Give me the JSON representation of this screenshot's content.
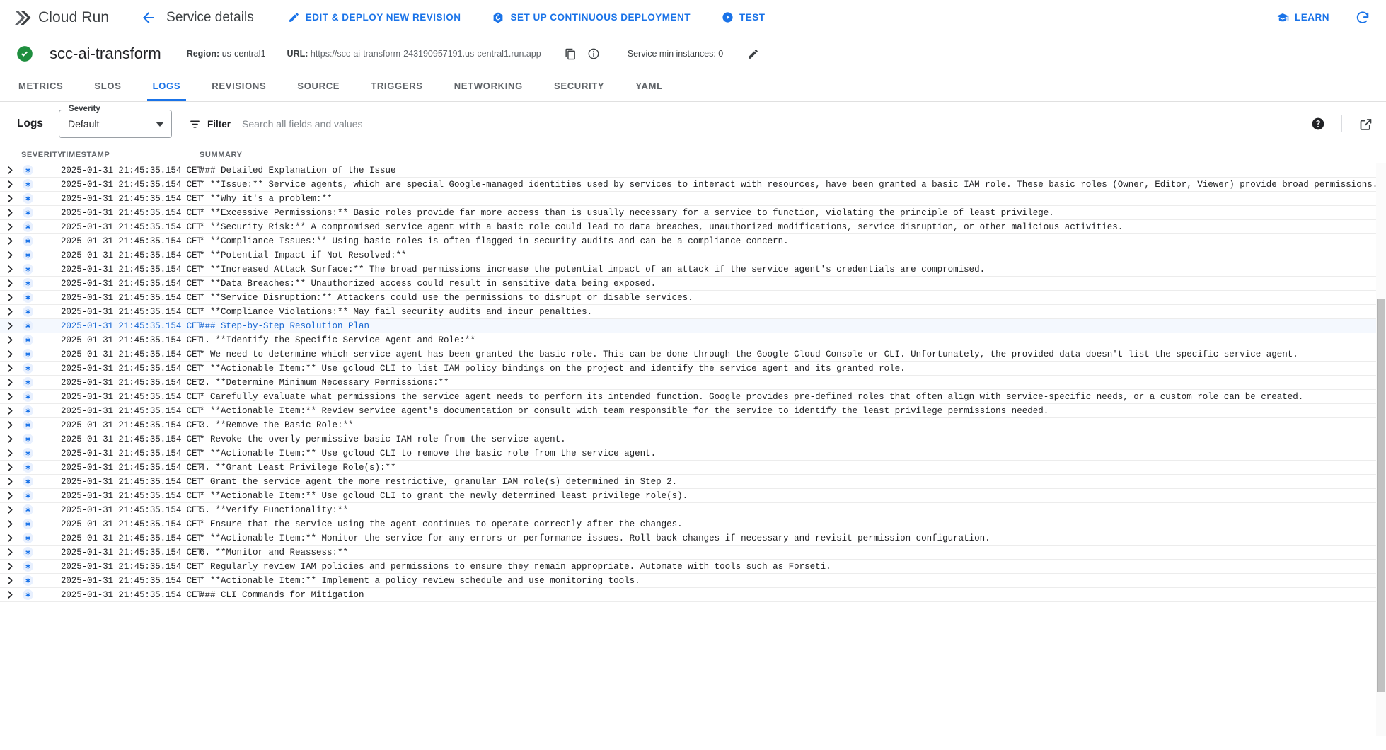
{
  "appbar": {
    "logo_icon": "cloud-run-logo",
    "product_name": "Cloud Run",
    "back_icon": "arrow-back-icon",
    "page_heading": "Service details",
    "actions": [
      {
        "icon": "pencil-edit-icon",
        "label": "EDIT & DEPLOY NEW REVISION"
      },
      {
        "icon": "continuous-deployment-icon",
        "label": "SET UP CONTINUOUS DEPLOYMENT"
      },
      {
        "icon": "play-circle-icon",
        "label": "TEST"
      }
    ],
    "learn": {
      "icon": "graduation-cap-icon",
      "label": "LEARN"
    },
    "refresh_icon": "refresh-icon",
    "accent_color": "#1a73e8"
  },
  "service": {
    "status_icon": "status-ok-check-icon",
    "status_color": "#1e8e3e",
    "name": "scc-ai-transform",
    "region_label": "Region:",
    "region_value": "us-central1",
    "url_label": "URL:",
    "url_value": "https://scc-ai-transform-243190957191.us-central1.run.app",
    "copy_icon": "copy-icon",
    "info_icon": "info-circle-icon",
    "min_instances_label": "Service min instances: 0",
    "edit_icon": "pencil-edit-icon"
  },
  "tabs": [
    {
      "label": "METRICS",
      "active": false
    },
    {
      "label": "SLOS",
      "active": false
    },
    {
      "label": "LOGS",
      "active": true
    },
    {
      "label": "REVISIONS",
      "active": false
    },
    {
      "label": "SOURCE",
      "active": false
    },
    {
      "label": "TRIGGERS",
      "active": false
    },
    {
      "label": "NETWORKING",
      "active": false
    },
    {
      "label": "SECURITY",
      "active": false
    },
    {
      "label": "YAML",
      "active": false
    }
  ],
  "logs_toolbar": {
    "title": "Logs",
    "severity": {
      "legend": "Severity",
      "value": "Default",
      "caret_icon": "chevron-down-icon"
    },
    "filter": {
      "icon": "filter-lines-icon",
      "label": "Filter"
    },
    "search": {
      "value": "",
      "placeholder": "Search all fields and values"
    },
    "help_icon": "help-circle-icon",
    "open_new_icon": "open-in-new-icon"
  },
  "log_table": {
    "columns": {
      "severity": "SEVERITY",
      "timestamp": "TIMESTAMP",
      "summary": "SUMMARY"
    },
    "expand_icon": "chevron-right-icon",
    "severity_icon": "asterisk-default-severity-icon",
    "rows": [
      {
        "timestamp": "2025-01-31 21:45:35.154 CET",
        "summary": "### Detailed Explanation of the Issue",
        "selected": false
      },
      {
        "timestamp": "2025-01-31 21:45:35.154 CET",
        "summary": "* **Issue:** Service agents, which are special Google-managed identities used by services to interact with resources, have been granted a basic IAM role. These basic roles (Owner, Editor, Viewer) provide broad permissions. Granting a service agen",
        "selected": false
      },
      {
        "timestamp": "2025-01-31 21:45:35.154 CET",
        "summary": "* **Why it's a problem:**",
        "selected": false
      },
      {
        "timestamp": "2025-01-31 21:45:35.154 CET",
        "summary": "* **Excessive Permissions:** Basic roles provide far more access than is usually necessary for a service to function, violating the principle of least privilege.",
        "selected": false
      },
      {
        "timestamp": "2025-01-31 21:45:35.154 CET",
        "summary": "* **Security Risk:** A compromised service agent with a basic role could lead to data breaches, unauthorized modifications, service disruption, or other malicious activities.",
        "selected": false
      },
      {
        "timestamp": "2025-01-31 21:45:35.154 CET",
        "summary": "* **Compliance Issues:** Using basic roles is often flagged in security audits and can be a compliance concern.",
        "selected": false
      },
      {
        "timestamp": "2025-01-31 21:45:35.154 CET",
        "summary": "* **Potential Impact if Not Resolved:**",
        "selected": false
      },
      {
        "timestamp": "2025-01-31 21:45:35.154 CET",
        "summary": "* **Increased Attack Surface:** The broad permissions increase the potential impact of an attack if the service agent's credentials are compromised.",
        "selected": false
      },
      {
        "timestamp": "2025-01-31 21:45:35.154 CET",
        "summary": "* **Data Breaches:** Unauthorized access could result in sensitive data being exposed.",
        "selected": false
      },
      {
        "timestamp": "2025-01-31 21:45:35.154 CET",
        "summary": "* **Service Disruption:** Attackers could use the permissions to disrupt or disable services.",
        "selected": false
      },
      {
        "timestamp": "2025-01-31 21:45:35.154 CET",
        "summary": "* **Compliance Violations:** May fail security audits and incur penalties.",
        "selected": false
      },
      {
        "timestamp": "2025-01-31 21:45:35.154 CET",
        "summary": "### Step-by-Step Resolution Plan",
        "selected": true
      },
      {
        "timestamp": "2025-01-31 21:45:35.154 CET",
        "summary": "1. **Identify the Specific Service Agent and Role:**",
        "selected": false
      },
      {
        "timestamp": "2025-01-31 21:45:35.154 CET",
        "summary": "* We need to determine which service agent has been granted the basic role. This can be done through the Google Cloud Console or CLI. Unfortunately, the provided data doesn't list the specific service agent.",
        "selected": false
      },
      {
        "timestamp": "2025-01-31 21:45:35.154 CET",
        "summary": "* **Actionable Item:** Use gcloud CLI to list IAM policy bindings on the project and identify the service agent and its granted role.",
        "selected": false
      },
      {
        "timestamp": "2025-01-31 21:45:35.154 CET",
        "summary": "2. **Determine Minimum Necessary Permissions:**",
        "selected": false
      },
      {
        "timestamp": "2025-01-31 21:45:35.154 CET",
        "summary": "* Carefully evaluate what permissions the service agent needs to perform its intended function. Google provides pre-defined roles that often align with service-specific needs, or a custom role can be created.",
        "selected": false
      },
      {
        "timestamp": "2025-01-31 21:45:35.154 CET",
        "summary": "* **Actionable Item:** Review service agent's documentation or consult with team responsible for the service to identify the least privilege permissions needed.",
        "selected": false
      },
      {
        "timestamp": "2025-01-31 21:45:35.154 CET",
        "summary": "3. **Remove the Basic Role:**",
        "selected": false
      },
      {
        "timestamp": "2025-01-31 21:45:35.154 CET",
        "summary": "* Revoke the overly permissive basic IAM role from the service agent.",
        "selected": false
      },
      {
        "timestamp": "2025-01-31 21:45:35.154 CET",
        "summary": "* **Actionable Item:** Use gcloud CLI to remove the basic role from the service agent.",
        "selected": false
      },
      {
        "timestamp": "2025-01-31 21:45:35.154 CET",
        "summary": "4. **Grant Least Privilege Role(s):**",
        "selected": false
      },
      {
        "timestamp": "2025-01-31 21:45:35.154 CET",
        "summary": "* Grant the service agent the more restrictive, granular IAM role(s) determined in Step 2.",
        "selected": false
      },
      {
        "timestamp": "2025-01-31 21:45:35.154 CET",
        "summary": "* **Actionable Item:** Use gcloud CLI to grant the newly determined least privilege role(s).",
        "selected": false
      },
      {
        "timestamp": "2025-01-31 21:45:35.154 CET",
        "summary": "5. **Verify Functionality:**",
        "selected": false
      },
      {
        "timestamp": "2025-01-31 21:45:35.154 CET",
        "summary": "* Ensure that the service using the agent continues to operate correctly after the changes.",
        "selected": false
      },
      {
        "timestamp": "2025-01-31 21:45:35.154 CET",
        "summary": "* **Actionable Item:** Monitor the service for any errors or performance issues. Roll back changes if necessary and revisit permission configuration.",
        "selected": false
      },
      {
        "timestamp": "2025-01-31 21:45:35.154 CET",
        "summary": "6. **Monitor and Reassess:**",
        "selected": false
      },
      {
        "timestamp": "2025-01-31 21:45:35.154 CET",
        "summary": "* Regularly review IAM policies and permissions to ensure they remain appropriate. Automate with tools such as Forseti.",
        "selected": false
      },
      {
        "timestamp": "2025-01-31 21:45:35.154 CET",
        "summary": "* **Actionable Item:** Implement a policy review schedule and use monitoring tools.",
        "selected": false
      },
      {
        "timestamp": "2025-01-31 21:45:35.154 CET",
        "summary": "### CLI Commands for Mitigation",
        "selected": false
      }
    ]
  }
}
